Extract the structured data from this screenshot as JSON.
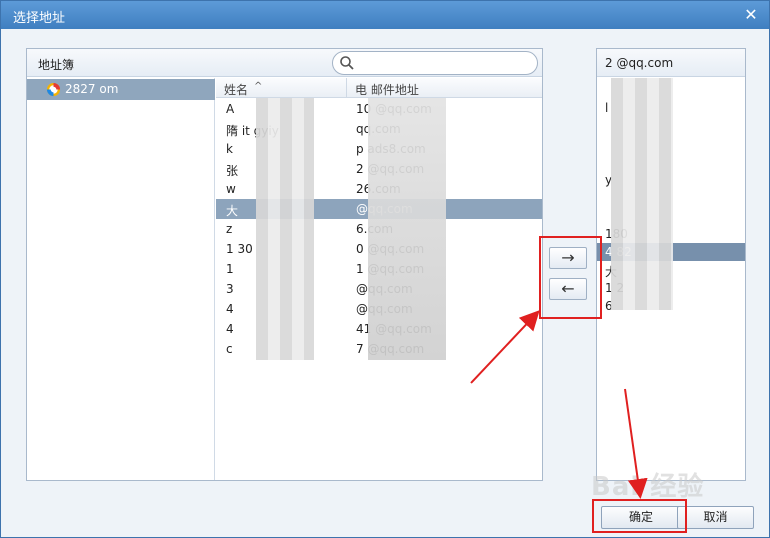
{
  "window": {
    "title": "选择地址",
    "close_glyph": "✕"
  },
  "left_panel": {
    "addressbook_label": "地址簿",
    "search_placeholder": "",
    "tree": [
      {
        "label": "2827        om",
        "icon": "qq-logo-icon"
      }
    ],
    "columns": {
      "name": "姓名",
      "sort_glyph": "^",
      "email": "电  邮件地址"
    },
    "rows": [
      {
        "name": "A",
        "email": "10        @qq.com",
        "selected": false
      },
      {
        "name": "隋        it gyiy",
        "email": "         qq.com",
        "selected": false
      },
      {
        "name": "k",
        "email": "p       ads8.com",
        "selected": false
      },
      {
        "name": "张",
        "email": "2       @qq.com",
        "selected": false
      },
      {
        "name": "w",
        "email": "         26.com",
        "selected": false
      },
      {
        "name": "大",
        "email": "         @qq.com",
        "selected": true
      },
      {
        "name": "z",
        "email": "         6.com",
        "selected": false
      },
      {
        "name": "1          30",
        "email": "0        @qq.com",
        "selected": false
      },
      {
        "name": "1",
        "email": "1        @qq.com",
        "selected": false
      },
      {
        "name": "3",
        "email": "         @qq.com",
        "selected": false
      },
      {
        "name": "4",
        "email": "         @qq.com",
        "selected": false
      },
      {
        "name": "4",
        "email": "41       @qq.com",
        "selected": false
      },
      {
        "name": "c",
        "email": "7        @qq.com",
        "selected": false
      }
    ]
  },
  "transfer": {
    "add_glyph": "→",
    "remove_glyph": "←"
  },
  "right_panel": {
    "header": "2        @qq.com",
    "items": [
      {
        "text": "",
        "selected": false
      },
      {
        "text": "l",
        "selected": false
      },
      {
        "text": "",
        "selected": false
      },
      {
        "text": "",
        "selected": false
      },
      {
        "text": "",
        "selected": false
      },
      {
        "text": "            y",
        "selected": false
      },
      {
        "text": "",
        "selected": false
      },
      {
        "text": "",
        "selected": false
      },
      {
        "text": "         180",
        "selected": false
      },
      {
        "text": "4         82",
        "selected": true
      },
      {
        "text": "大",
        "selected": false
      },
      {
        "text": "1         2",
        "selected": false
      },
      {
        "text": "         6",
        "selected": false
      }
    ]
  },
  "footer": {
    "ok_label": "确定",
    "cancel_label": "取消"
  },
  "watermark": "Bai 经验",
  "colors": {
    "highlight": "#e02020",
    "selection": "#8da4bc",
    "titlebar": "#4a86c4"
  }
}
